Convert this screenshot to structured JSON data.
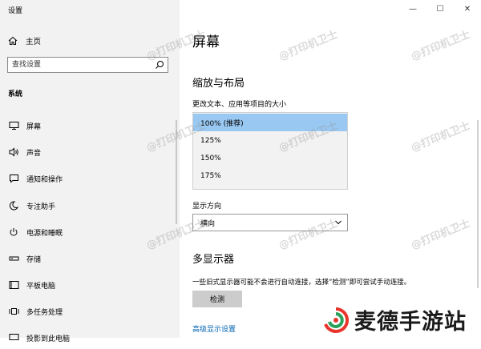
{
  "app": {
    "title": "设置"
  },
  "window_controls": {
    "minimize": "—",
    "maximize": "☐",
    "close": "✕"
  },
  "sidebar": {
    "home_label": "主页",
    "search_placeholder": "查找设置",
    "section_label": "系统",
    "items": [
      {
        "label": "屏幕",
        "icon": "display-icon"
      },
      {
        "label": "声音",
        "icon": "speaker-icon"
      },
      {
        "label": "通知和操作",
        "icon": "notification-icon"
      },
      {
        "label": "专注助手",
        "icon": "moon-icon"
      },
      {
        "label": "电源和睡眠",
        "icon": "power-icon"
      },
      {
        "label": "存储",
        "icon": "storage-icon"
      },
      {
        "label": "平板电脑",
        "icon": "tablet-icon"
      },
      {
        "label": "多任务处理",
        "icon": "multitask-icon"
      },
      {
        "label": "投影到此电脑",
        "icon": "project-icon"
      }
    ]
  },
  "main": {
    "page_title": "屏幕",
    "scale_heading": "缩放与布局",
    "scale_label": "更改文本、应用等项目的大小",
    "scale_options": [
      "100% (推荐)",
      "125%",
      "150%",
      "175%"
    ],
    "scale_selected_index": 0,
    "orientation_label": "显示方向",
    "orientation_value": "横向",
    "multi_heading": "多显示器",
    "multi_desc": "一些旧式显示器可能不会进行自动连接，选择“检测”即可尝试手动连接。",
    "detect_button": "检测",
    "advanced_link": "高级显示设置"
  },
  "watermark": "@打印机卫士",
  "brand": {
    "text": "麦德手游站"
  },
  "colors": {
    "selected_option": "#99c9f2",
    "link": "#0063b1",
    "sidebar_bg": "#f2f2f2",
    "button_bg": "#cccccc"
  }
}
